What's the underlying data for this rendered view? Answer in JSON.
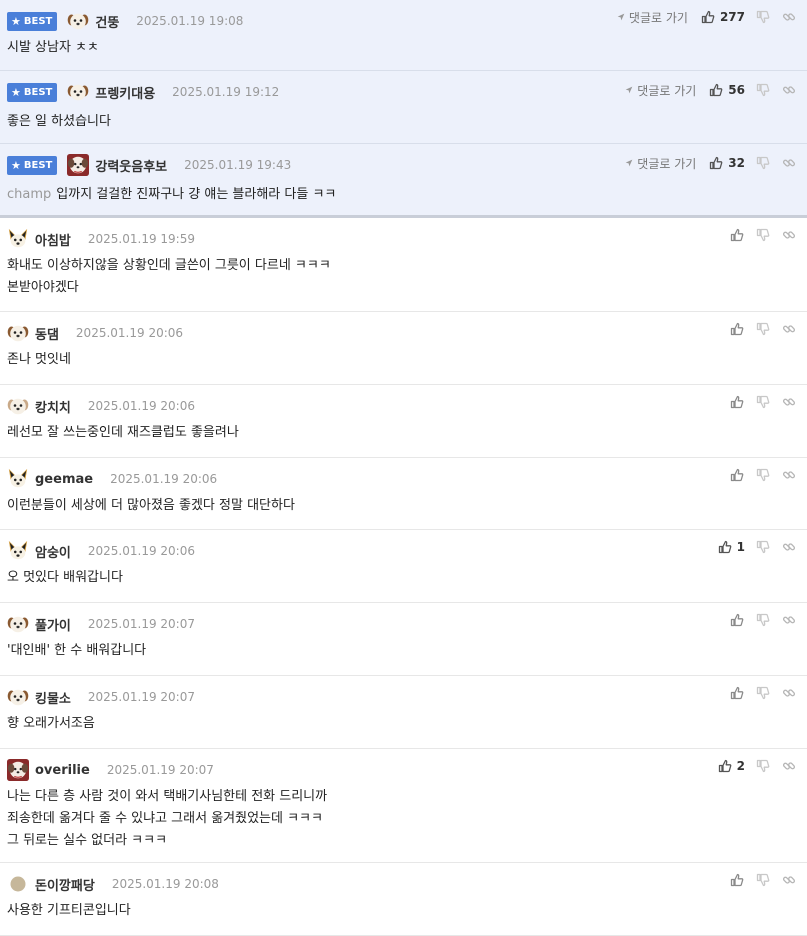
{
  "labels": {
    "best": "BEST",
    "goto": "댓글로 가기"
  },
  "comments": [
    {
      "best": true,
      "nick": "건뚱",
      "date": "2025.01.19 19:08",
      "prefix": "",
      "lines": [
        "시발 상남자 ㅊㅊ"
      ],
      "likes": "277",
      "avatar": "pup"
    },
    {
      "best": true,
      "nick": "프렝키대용",
      "date": "2025.01.19 19:12",
      "prefix": "",
      "lines": [
        "좋은 일 하셨습니다"
      ],
      "likes": "56",
      "avatar": "pup"
    },
    {
      "best": true,
      "nick": "강력웃음후보",
      "date": "2025.01.19 19:43",
      "prefix": "champ",
      "lines": [
        "입까지 걸걸한 진짜구나 걍 얘는 블라해라 다들 ㅋㅋ"
      ],
      "likes": "32",
      "avatar": "devil"
    },
    {
      "best": false,
      "nick": "아침밥",
      "date": "2025.01.19 19:59",
      "prefix": "",
      "lines": [
        "화내도 이상하지않을 상황인데 글쓴이 그릇이 다르네 ㅋㅋㅋ",
        "본받아야겠다"
      ],
      "likes": "",
      "avatar": "fox"
    },
    {
      "best": false,
      "nick": "동댐",
      "date": "2025.01.19 20:06",
      "prefix": "",
      "lines": [
        "존나 멋잇네"
      ],
      "likes": "",
      "avatar": "pup"
    },
    {
      "best": false,
      "nick": "캉치치",
      "date": "2025.01.19 20:06",
      "prefix": "",
      "lines": [
        "레선모 잘 쓰는중인데 재즈클럽도 좋을려나"
      ],
      "likes": "",
      "avatar": "puplight"
    },
    {
      "best": false,
      "nick": "geemae",
      "date": "2025.01.19 20:06",
      "prefix": "",
      "lines": [
        "이런분들이 세상에 더 많아졌음 좋겠다 정말 대단하다"
      ],
      "likes": "",
      "avatar": "fox"
    },
    {
      "best": false,
      "nick": "암숭이",
      "date": "2025.01.19 20:06",
      "prefix": "",
      "lines": [
        "오 멋있다 배워갑니다"
      ],
      "likes": "1",
      "avatar": "fox"
    },
    {
      "best": false,
      "nick": "풀가이",
      "date": "2025.01.19 20:07",
      "prefix": "",
      "lines": [
        "'대인배' 한 수 배워갑니다"
      ],
      "likes": "",
      "avatar": "pup"
    },
    {
      "best": false,
      "nick": "킹물소",
      "date": "2025.01.19 20:07",
      "prefix": "",
      "lines": [
        "향 오래가서조음"
      ],
      "likes": "",
      "avatar": "pup"
    },
    {
      "best": false,
      "nick": "overilie",
      "date": "2025.01.19 20:07",
      "prefix": "",
      "lines": [
        "나는 다른 층 사람 것이 와서 택배기사님한테 전화 드리니까",
        "죄송한데 옮겨다 줄 수 있냐고 그래서 옮겨줬었는데 ㅋㅋㅋ",
        "그 뒤로는 실수 없더라 ㅋㅋㅋ"
      ],
      "likes": "2",
      "avatar": "devil"
    },
    {
      "best": false,
      "nick": "돈이깡패당",
      "date": "2025.01.19 20:08",
      "prefix": "",
      "lines": [
        "사용한 기프티콘입니다"
      ],
      "likes": "",
      "avatar": "dot"
    }
  ]
}
